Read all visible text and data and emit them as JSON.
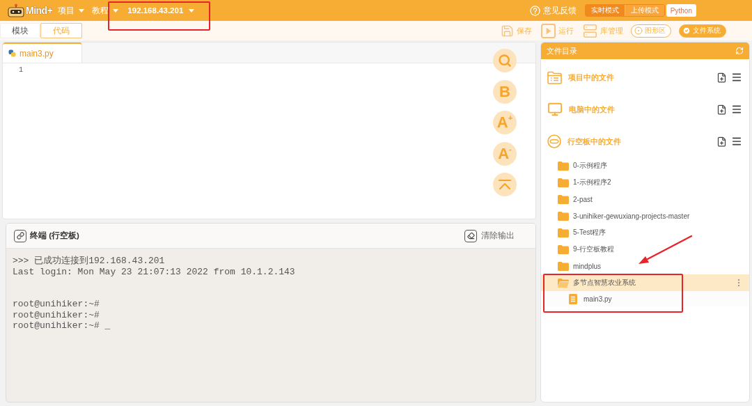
{
  "menubar": {
    "logo": "Mind+",
    "menus": [
      {
        "label": "项目"
      },
      {
        "label": "教程"
      }
    ],
    "device": {
      "label": "192.168.43.201",
      "highlighted": true
    },
    "feedback": "意见反馈",
    "modes": [
      {
        "label": "实时模式",
        "selected": true
      },
      {
        "label": "上传模式",
        "selected": false
      }
    ],
    "python_mode": {
      "label": "Python",
      "on": true
    }
  },
  "view_tabs": [
    {
      "label": "模块",
      "selected": false
    },
    {
      "label": "代码",
      "selected": true
    }
  ],
  "toolbar": [
    {
      "kind": "save",
      "label": "保存"
    },
    {
      "kind": "run",
      "label": "运行"
    },
    {
      "kind": "library",
      "label": "库管理"
    },
    {
      "kind": "toggle",
      "label": "图形区",
      "selected": false
    },
    {
      "kind": "toggle",
      "label": "文件系统",
      "selected": true
    }
  ],
  "editor": {
    "tabs": [
      {
        "label": "main3.py",
        "selected": true
      }
    ],
    "line_numbers": [
      "1"
    ],
    "tools": [
      {
        "kind": "search"
      },
      {
        "kind": "bold",
        "label": "B"
      },
      {
        "kind": "font_larger",
        "label": "A$^{+}$"
      },
      {
        "kind": "font_smaller",
        "label": "A$^{-}$"
      },
      {
        "kind": "to_top"
      }
    ]
  },
  "terminal": {
    "title": "终端 (行空板)",
    "clear_label": "清除输出",
    "blocks": [
      [
        ">>> 已成功连接到192.168.43.201",
        "Last login: Mon May 23 21:07:13 2022 from 10.1.2.143"
      ],
      [
        "root@unihiker:~#",
        "root@unihiker:~#",
        "root@unihiker:~# _"
      ]
    ]
  },
  "file_panel": {
    "title": "文件目录",
    "sections": [
      {
        "kind": "project",
        "label": "项目中的文件"
      },
      {
        "kind": "computer",
        "label": "电脑中的文件"
      },
      {
        "kind": "board",
        "label": "行空板中的文件",
        "children": [
          {
            "kind": "folder",
            "label": "0-示例程序",
            "selected": false,
            "expanded": false,
            "highlighted": false
          },
          {
            "kind": "folder",
            "label": "1-示例程序2",
            "selected": false,
            "expanded": false,
            "highlighted": false
          },
          {
            "kind": "folder",
            "label": "2-past",
            "selected": false,
            "expanded": false,
            "highlighted": false
          },
          {
            "kind": "folder",
            "label": "3-unihiker-gewuxiang-projects-master",
            "selected": false,
            "expanded": false,
            "highlighted": false
          },
          {
            "kind": "folder",
            "label": "5-Test程序",
            "selected": false,
            "expanded": false,
            "highlighted": false
          },
          {
            "kind": "folder",
            "label": "9-行空板教程",
            "selected": false,
            "expanded": false,
            "highlighted": false
          },
          {
            "kind": "folder",
            "label": "mindplus",
            "selected": false,
            "expanded": false,
            "highlighted": false
          },
          {
            "kind": "folder",
            "label": "多节点智慧农业系统",
            "selected": true,
            "expanded": true,
            "highlighted": true,
            "children": [
              {
                "kind": "file",
                "label": "main3.py",
                "selected": false
              }
            ]
          }
        ]
      }
    ]
  }
}
